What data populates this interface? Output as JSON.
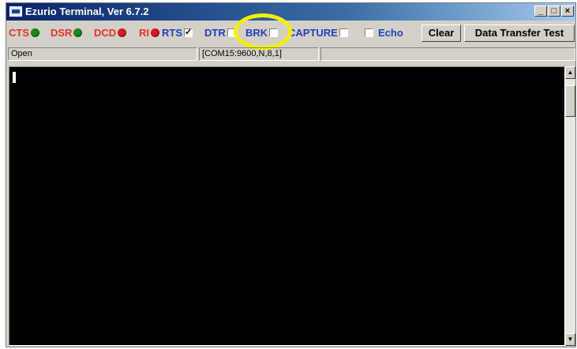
{
  "window": {
    "title": "Ezurio Terminal, Ver 6.7.2",
    "minimize_glyph": "_",
    "restore_glyph": "□",
    "close_glyph": "×"
  },
  "toolbar": {
    "cts_label": "CTS",
    "dsr_label": "DSR",
    "dcd_label": "DCD",
    "ri_label": "RI",
    "rts_label": "RTS",
    "dtr_label": "DTR",
    "brk_label": "BRK",
    "capture_label": "CAPTURE",
    "echo_label": "Echo",
    "clear_label": "Clear",
    "data_transfer_label": "Data Transfer Test",
    "check_glyph": "✓"
  },
  "signals": {
    "cts_on": true,
    "dsr_on": true,
    "dcd_on": false,
    "ri_on": false,
    "rts_checked": true,
    "dtr_checked": false,
    "brk_checked": false,
    "capture_checked": false,
    "echo_checked": false
  },
  "colors": {
    "signal_label": "#e8302a",
    "control_label": "#1f3fbf",
    "led_green": "#1a8a1a",
    "led_red": "#d41e1e",
    "highlight": "#f4f000"
  },
  "statusbar": {
    "state": "Open",
    "port": "[COM15:9600,N,8,1]"
  },
  "scrollbar": {
    "up_glyph": "▲",
    "down_glyph": "▼"
  }
}
